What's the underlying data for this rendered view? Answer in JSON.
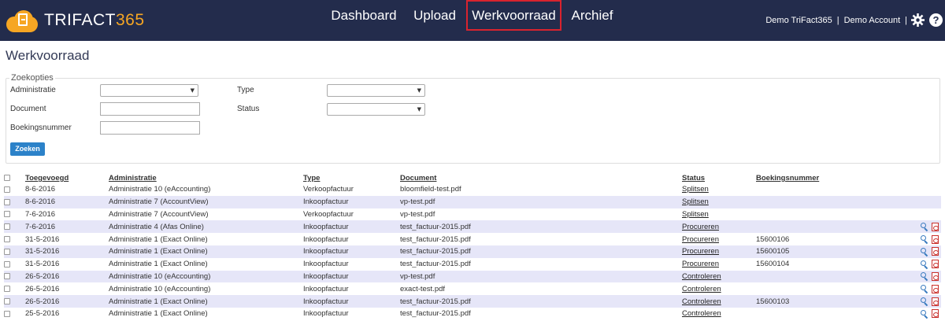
{
  "brand": {
    "name_prefix": "TRIFACT",
    "name_suffix": "365"
  },
  "nav": {
    "items": [
      {
        "label": "Dashboard"
      },
      {
        "label": "Upload"
      },
      {
        "label": "Werkvoorraad",
        "active": true
      },
      {
        "label": "Archief"
      }
    ]
  },
  "user": {
    "company": "Demo TriFact365",
    "separator": "|",
    "account": "Demo Account",
    "separator2": "|",
    "settings_icon": "gear-icon",
    "help_icon": "help-icon",
    "help_label": "?"
  },
  "page": {
    "title": "Werkvoorraad"
  },
  "search": {
    "legend": "Zoekopties",
    "administratie_label": "Administratie",
    "administratie_value": "",
    "document_label": "Document",
    "document_value": "",
    "boekingsnummer_label": "Boekingsnummer",
    "boekingsnummer_value": "",
    "type_label": "Type",
    "type_value": "",
    "status_label": "Status",
    "status_value": "",
    "button_label": "Zoeken"
  },
  "table": {
    "headers": {
      "added": "Toegevoegd",
      "administratie": "Administratie",
      "type": "Type",
      "document": "Document",
      "status": "Status",
      "boekingsnummer": "Boekingsnummer"
    },
    "rows": [
      {
        "added": "8-6-2016",
        "administratie": "Administratie 10 (eAccounting)",
        "type": "Verkoopfactuur",
        "document": "bloomfield-test.pdf",
        "status": "Splitsen",
        "boekingsnummer": "",
        "actions": false
      },
      {
        "added": "8-6-2016",
        "administratie": "Administratie 7 (AccountView)",
        "type": "Inkoopfactuur",
        "document": "vp-test.pdf",
        "status": "Splitsen",
        "boekingsnummer": "",
        "actions": false
      },
      {
        "added": "7-6-2016",
        "administratie": "Administratie 7 (AccountView)",
        "type": "Verkoopfactuur",
        "document": "vp-test.pdf",
        "status": "Splitsen",
        "boekingsnummer": "",
        "actions": false
      },
      {
        "added": "7-6-2016",
        "administratie": "Administratie 4 (Afas Online)",
        "type": "Inkoopfactuur",
        "document": "test_factuur-2015.pdf",
        "status": "Procureren",
        "boekingsnummer": "",
        "actions": true
      },
      {
        "added": "31-5-2016",
        "administratie": "Administratie 1 (Exact Online)",
        "type": "Inkoopfactuur",
        "document": "test_factuur-2015.pdf",
        "status": "Procureren",
        "boekingsnummer": "15600106",
        "actions": true
      },
      {
        "added": "31-5-2016",
        "administratie": "Administratie 1 (Exact Online)",
        "type": "Inkoopfactuur",
        "document": "test_factuur-2015.pdf",
        "status": "Procureren",
        "boekingsnummer": "15600105",
        "actions": true
      },
      {
        "added": "31-5-2016",
        "administratie": "Administratie 1 (Exact Online)",
        "type": "Inkoopfactuur",
        "document": "test_factuur-2015.pdf",
        "status": "Procureren",
        "boekingsnummer": "15600104",
        "actions": true
      },
      {
        "added": "26-5-2016",
        "administratie": "Administratie 10 (eAccounting)",
        "type": "Inkoopfactuur",
        "document": "vp-test.pdf",
        "status": "Controleren",
        "boekingsnummer": "",
        "actions": true
      },
      {
        "added": "26-5-2016",
        "administratie": "Administratie 10 (eAccounting)",
        "type": "Inkoopfactuur",
        "document": "exact-test.pdf",
        "status": "Controleren",
        "boekingsnummer": "",
        "actions": true
      },
      {
        "added": "26-5-2016",
        "administratie": "Administratie 1 (Exact Online)",
        "type": "Inkoopfactuur",
        "document": "test_factuur-2015.pdf",
        "status": "Controleren",
        "boekingsnummer": "15600103",
        "actions": true
      },
      {
        "added": "25-5-2016",
        "administratie": "Administratie 1 (Exact Online)",
        "type": "Inkoopfactuur",
        "document": "test_factuur-2015.pdf",
        "status": "Controleren",
        "boekingsnummer": "",
        "actions": true
      }
    ]
  },
  "colors": {
    "navbar": "#232c4c",
    "accent": "#f6a623",
    "active_border": "#d9232e",
    "row_alt": "#e6e6f8",
    "button": "#2c82c9"
  }
}
